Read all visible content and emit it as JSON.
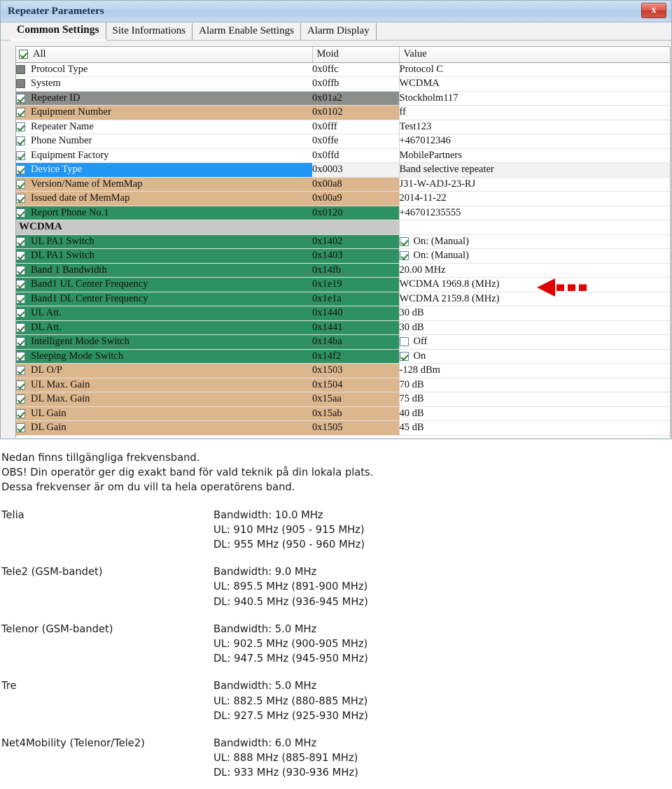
{
  "window": {
    "title": "Repeater Parameters",
    "close_label": "x"
  },
  "tabs": [
    {
      "label": "Common Settings",
      "active": true
    },
    {
      "label": "Site Informations",
      "active": false
    },
    {
      "label": "Alarm Enable Settings",
      "active": false
    },
    {
      "label": "Alarm Display",
      "active": false
    }
  ],
  "grid": {
    "columns": [
      "All",
      "Moid",
      "Value"
    ],
    "select_all_checked": true,
    "rows": [
      {
        "name": "Protocol Type",
        "moid": "0x0ffc",
        "value": "Protocol C",
        "check": "disabled",
        "tint": "none",
        "value_check": null
      },
      {
        "name": "System",
        "moid": "0x0ffb",
        "value": "WCDMA",
        "check": "disabled",
        "tint": "none",
        "value_check": null
      },
      {
        "name": "Repeater ID",
        "moid": "0x01a2",
        "value": "Stockholm117",
        "check": "checked",
        "tint": "gray",
        "value_check": null
      },
      {
        "name": "Equipment Number",
        "moid": "0x0102",
        "value": "ff",
        "check": "checked",
        "tint": "tan",
        "value_check": null
      },
      {
        "name": "Repeater Name",
        "moid": "0x0fff",
        "value": "Test123",
        "check": "checked",
        "tint": "none",
        "value_check": null
      },
      {
        "name": "Phone Number",
        "moid": "0x0ffe",
        "value": "+467012346",
        "check": "checked",
        "tint": "none",
        "value_check": null
      },
      {
        "name": "Equipment Factory",
        "moid": "0x0ffd",
        "value": "MobilePartners",
        "check": "checked",
        "tint": "none",
        "value_check": null
      },
      {
        "name": "Device Type",
        "moid": "0x0003",
        "value": "Band selective repeater",
        "check": "checked",
        "tint": "sel",
        "value_check": null
      },
      {
        "name": "Version/Name of MemMap",
        "moid": "0x00a8",
        "value": "J31-W-ADJ-23-RJ",
        "check": "checked",
        "tint": "tan",
        "value_check": null
      },
      {
        "name": "Issued date of MemMap",
        "moid": "0x00a9",
        "value": "2014-11-22",
        "check": "checked",
        "tint": "tan",
        "value_check": null
      },
      {
        "name": "Report Phone No.1",
        "moid": "0x0120",
        "value": "+46701235555",
        "check": "checked",
        "tint": "green",
        "value_check": null
      },
      {
        "name": "WCDMA",
        "moid": "",
        "value": "",
        "check": "none",
        "tint": "section",
        "value_check": null
      },
      {
        "name": "UL PA1 Switch",
        "moid": "0x1402",
        "value": "On: (Manual)",
        "check": "checked",
        "tint": "green",
        "value_check": "checked"
      },
      {
        "name": "DL PA1 Switch",
        "moid": "0x1403",
        "value": "On: (Manual)",
        "check": "checked",
        "tint": "green",
        "value_check": "checked"
      },
      {
        "name": "Band 1 Bandwidth",
        "moid": "0x14fb",
        "value": "20.00 MHz",
        "check": "checked",
        "tint": "green",
        "value_check": null
      },
      {
        "name": "Band1 UL Center Frequency",
        "moid": "0x1e19",
        "value": "WCDMA  1969.8 (MHz)",
        "check": "checked",
        "tint": "green",
        "value_check": null
      },
      {
        "name": "Band1 DL Center Frequency",
        "moid": "0x1e1a",
        "value": "WCDMA  2159.8 (MHz)",
        "check": "checked",
        "tint": "green",
        "value_check": null
      },
      {
        "name": "UL Att.",
        "moid": "0x1440",
        "value": "30 dB",
        "check": "checked",
        "tint": "green",
        "value_check": null
      },
      {
        "name": "DL Att.",
        "moid": "0x1441",
        "value": "30 dB",
        "check": "checked",
        "tint": "green",
        "value_check": null
      },
      {
        "name": "Intelligent Mode Switch",
        "moid": "0x14ba",
        "value": "Off",
        "check": "checked",
        "tint": "green",
        "value_check": "unchecked"
      },
      {
        "name": "Sleeping Mode Switch",
        "moid": "0x14f2",
        "value": "On",
        "check": "checked",
        "tint": "green",
        "value_check": "checked"
      },
      {
        "name": "DL O/P",
        "moid": "0x1503",
        "value": "-128 dBm",
        "check": "checked",
        "tint": "tan",
        "value_check": null
      },
      {
        "name": "UL Max. Gain",
        "moid": "0x1504",
        "value": "70 dB",
        "check": "checked",
        "tint": "tan",
        "value_check": null
      },
      {
        "name": "DL Max. Gain",
        "moid": "0x15aa",
        "value": "75 dB",
        "check": "checked",
        "tint": "tan",
        "value_check": null
      },
      {
        "name": "UL Gain",
        "moid": "0x15ab",
        "value": "40 dB",
        "check": "checked",
        "tint": "tan",
        "value_check": null
      },
      {
        "name": "DL Gain",
        "moid": "0x1505",
        "value": "45 dB",
        "check": "checked",
        "tint": "tan",
        "value_check": null
      }
    ]
  },
  "annotation": {
    "arrow_color": "#e00000",
    "points_at": "Band1 UL Center Frequency"
  },
  "notes": {
    "intro": [
      "Nedan finns tillgängliga frekvensband.",
      "OBS! Din operatör ger dig exakt band för vald teknik på din lokala plats.",
      "Dessa frekvenser är om du vill ta hela operatörens band."
    ],
    "operators": [
      {
        "name": "Telia",
        "bandwidth": "Bandwidth: 10.0 MHz",
        "ul": "UL: 910 MHz (905 - 915 MHz)",
        "dl": "DL: 955 MHz (950 - 960 MHz)"
      },
      {
        "name": "Tele2 (GSM-bandet)",
        "bandwidth": "Bandwidth: 9.0 MHz",
        "ul": "UL: 895.5 MHz (891-900 MHz)",
        "dl": "DL: 940.5 MHz (936-945 MHz)"
      },
      {
        "name": "Telenor (GSM-bandet)",
        "bandwidth": "Bandwidth: 5.0 MHz",
        "ul": "UL: 902.5 MHz (900-905 MHz)",
        "dl": "DL: 947.5 MHz (945-950 MHz)"
      },
      {
        "name": "Tre",
        "bandwidth": "Bandwidth: 5.0 MHz",
        "ul": "UL: 882.5 MHz (880-885 MHz)",
        "dl": "DL: 927.5 MHz (925-930 MHz)"
      },
      {
        "name": "Net4Mobility (Telenor/Tele2)",
        "bandwidth": "Bandwidth: 6.0 MHz",
        "ul": "UL: 888 MHz (885-891 MHz)",
        "dl": "DL: 933 MHz (930-936 MHz)"
      }
    ]
  }
}
